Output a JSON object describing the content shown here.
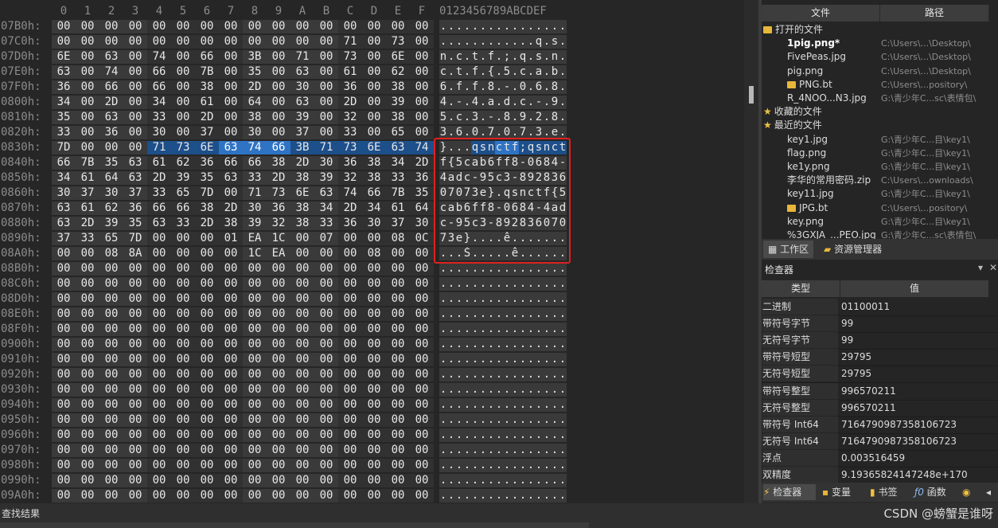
{
  "hex": {
    "col_headers": [
      "0",
      "1",
      "2",
      "3",
      "4",
      "5",
      "6",
      "7",
      "8",
      "9",
      "A",
      "B",
      "C",
      "D",
      "E",
      "F"
    ],
    "ascii_header": "0123456789ABCDEF",
    "rows": [
      {
        "addr": "07B0h:",
        "bytes": [
          "00",
          "00",
          "00",
          "00",
          "00",
          "00",
          "00",
          "00",
          "00",
          "00",
          "00",
          "00",
          "00",
          "00",
          "00",
          "00"
        ],
        "ascii": "................"
      },
      {
        "addr": "07C0h:",
        "bytes": [
          "00",
          "00",
          "00",
          "00",
          "00",
          "00",
          "00",
          "00",
          "00",
          "00",
          "00",
          "00",
          "71",
          "00",
          "73",
          "00"
        ],
        "ascii": "............q.s."
      },
      {
        "addr": "07D0h:",
        "bytes": [
          "6E",
          "00",
          "63",
          "00",
          "74",
          "00",
          "66",
          "00",
          "3B",
          "00",
          "71",
          "00",
          "73",
          "00",
          "6E",
          "00"
        ],
        "ascii": "n.c.t.f.;.q.s.n."
      },
      {
        "addr": "07E0h:",
        "bytes": [
          "63",
          "00",
          "74",
          "00",
          "66",
          "00",
          "7B",
          "00",
          "35",
          "00",
          "63",
          "00",
          "61",
          "00",
          "62",
          "00"
        ],
        "ascii": "c.t.f.{.5.c.a.b."
      },
      {
        "addr": "07F0h:",
        "bytes": [
          "36",
          "00",
          "66",
          "00",
          "66",
          "00",
          "38",
          "00",
          "2D",
          "00",
          "30",
          "00",
          "36",
          "00",
          "38",
          "00"
        ],
        "ascii": "6.f.f.8.-.0.6.8."
      },
      {
        "addr": "0800h:",
        "bytes": [
          "34",
          "00",
          "2D",
          "00",
          "34",
          "00",
          "61",
          "00",
          "64",
          "00",
          "63",
          "00",
          "2D",
          "00",
          "39",
          "00"
        ],
        "ascii": "4.-.4.a.d.c.-.9."
      },
      {
        "addr": "0810h:",
        "bytes": [
          "35",
          "00",
          "63",
          "00",
          "33",
          "00",
          "2D",
          "00",
          "38",
          "00",
          "39",
          "00",
          "32",
          "00",
          "38",
          "00"
        ],
        "ascii": "5.c.3.-.8.9.2.8."
      },
      {
        "addr": "0820h:",
        "bytes": [
          "33",
          "00",
          "36",
          "00",
          "30",
          "00",
          "37",
          "00",
          "30",
          "00",
          "37",
          "00",
          "33",
          "00",
          "65",
          "00"
        ],
        "ascii": "3.6.0.7.0.7.3.e."
      },
      {
        "addr": "0830h:",
        "bytes": [
          "7D",
          "00",
          "00",
          "00",
          "71",
          "73",
          "6E",
          "63",
          "74",
          "66",
          "3B",
          "71",
          "73",
          "6E",
          "63",
          "74"
        ],
        "ascii": "}...qsnctf;qsnct"
      },
      {
        "addr": "0840h:",
        "bytes": [
          "66",
          "7B",
          "35",
          "63",
          "61",
          "62",
          "36",
          "66",
          "66",
          "38",
          "2D",
          "30",
          "36",
          "38",
          "34",
          "2D"
        ],
        "ascii": "f{5cab6ff8-0684-"
      },
      {
        "addr": "0850h:",
        "bytes": [
          "34",
          "61",
          "64",
          "63",
          "2D",
          "39",
          "35",
          "63",
          "33",
          "2D",
          "38",
          "39",
          "32",
          "38",
          "33",
          "36"
        ],
        "ascii": "4adc-95c3-892836"
      },
      {
        "addr": "0860h:",
        "bytes": [
          "30",
          "37",
          "30",
          "37",
          "33",
          "65",
          "7D",
          "00",
          "71",
          "73",
          "6E",
          "63",
          "74",
          "66",
          "7B",
          "35"
        ],
        "ascii": "07073e}.qsnctf{5"
      },
      {
        "addr": "0870h:",
        "bytes": [
          "63",
          "61",
          "62",
          "36",
          "66",
          "66",
          "38",
          "2D",
          "30",
          "36",
          "38",
          "34",
          "2D",
          "34",
          "61",
          "64"
        ],
        "ascii": "cab6ff8-0684-4ad"
      },
      {
        "addr": "0880h:",
        "bytes": [
          "63",
          "2D",
          "39",
          "35",
          "63",
          "33",
          "2D",
          "38",
          "39",
          "32",
          "38",
          "33",
          "36",
          "30",
          "37",
          "30"
        ],
        "ascii": "c-95c3-892836070"
      },
      {
        "addr": "0890h:",
        "bytes": [
          "37",
          "33",
          "65",
          "7D",
          "00",
          "00",
          "00",
          "01",
          "EA",
          "1C",
          "00",
          "07",
          "00",
          "00",
          "08",
          "0C"
        ],
        "ascii": "73e}....ê......."
      },
      {
        "addr": "08A0h:",
        "bytes": [
          "00",
          "00",
          "08",
          "8A",
          "00",
          "00",
          "00",
          "00",
          "1C",
          "EA",
          "00",
          "00",
          "00",
          "08",
          "00",
          "00"
        ],
        "ascii": "...Š.....ê......"
      },
      {
        "addr": "08B0h:",
        "bytes": [
          "00",
          "00",
          "00",
          "00",
          "00",
          "00",
          "00",
          "00",
          "00",
          "00",
          "00",
          "00",
          "00",
          "00",
          "00",
          "00"
        ],
        "ascii": "................"
      },
      {
        "addr": "08C0h:",
        "bytes": [
          "00",
          "00",
          "00",
          "00",
          "00",
          "00",
          "00",
          "00",
          "00",
          "00",
          "00",
          "00",
          "00",
          "00",
          "00",
          "00"
        ],
        "ascii": "................"
      },
      {
        "addr": "08D0h:",
        "bytes": [
          "00",
          "00",
          "00",
          "00",
          "00",
          "00",
          "00",
          "00",
          "00",
          "00",
          "00",
          "00",
          "00",
          "00",
          "00",
          "00"
        ],
        "ascii": "................"
      },
      {
        "addr": "08E0h:",
        "bytes": [
          "00",
          "00",
          "00",
          "00",
          "00",
          "00",
          "00",
          "00",
          "00",
          "00",
          "00",
          "00",
          "00",
          "00",
          "00",
          "00"
        ],
        "ascii": "................"
      },
      {
        "addr": "08F0h:",
        "bytes": [
          "00",
          "00",
          "00",
          "00",
          "00",
          "00",
          "00",
          "00",
          "00",
          "00",
          "00",
          "00",
          "00",
          "00",
          "00",
          "00"
        ],
        "ascii": "................"
      },
      {
        "addr": "0900h:",
        "bytes": [
          "00",
          "00",
          "00",
          "00",
          "00",
          "00",
          "00",
          "00",
          "00",
          "00",
          "00",
          "00",
          "00",
          "00",
          "00",
          "00"
        ],
        "ascii": "................"
      },
      {
        "addr": "0910h:",
        "bytes": [
          "00",
          "00",
          "00",
          "00",
          "00",
          "00",
          "00",
          "00",
          "00",
          "00",
          "00",
          "00",
          "00",
          "00",
          "00",
          "00"
        ],
        "ascii": "................"
      },
      {
        "addr": "0920h:",
        "bytes": [
          "00",
          "00",
          "00",
          "00",
          "00",
          "00",
          "00",
          "00",
          "00",
          "00",
          "00",
          "00",
          "00",
          "00",
          "00",
          "00"
        ],
        "ascii": "................"
      },
      {
        "addr": "0930h:",
        "bytes": [
          "00",
          "00",
          "00",
          "00",
          "00",
          "00",
          "00",
          "00",
          "00",
          "00",
          "00",
          "00",
          "00",
          "00",
          "00",
          "00"
        ],
        "ascii": "................"
      },
      {
        "addr": "0940h:",
        "bytes": [
          "00",
          "00",
          "00",
          "00",
          "00",
          "00",
          "00",
          "00",
          "00",
          "00",
          "00",
          "00",
          "00",
          "00",
          "00",
          "00"
        ],
        "ascii": "................"
      },
      {
        "addr": "0950h:",
        "bytes": [
          "00",
          "00",
          "00",
          "00",
          "00",
          "00",
          "00",
          "00",
          "00",
          "00",
          "00",
          "00",
          "00",
          "00",
          "00",
          "00"
        ],
        "ascii": "................"
      },
      {
        "addr": "0960h:",
        "bytes": [
          "00",
          "00",
          "00",
          "00",
          "00",
          "00",
          "00",
          "00",
          "00",
          "00",
          "00",
          "00",
          "00",
          "00",
          "00",
          "00"
        ],
        "ascii": "................"
      },
      {
        "addr": "0970h:",
        "bytes": [
          "00",
          "00",
          "00",
          "00",
          "00",
          "00",
          "00",
          "00",
          "00",
          "00",
          "00",
          "00",
          "00",
          "00",
          "00",
          "00"
        ],
        "ascii": "................"
      },
      {
        "addr": "0980h:",
        "bytes": [
          "00",
          "00",
          "00",
          "00",
          "00",
          "00",
          "00",
          "00",
          "00",
          "00",
          "00",
          "00",
          "00",
          "00",
          "00",
          "00"
        ],
        "ascii": "................"
      },
      {
        "addr": "0990h:",
        "bytes": [
          "00",
          "00",
          "00",
          "00",
          "00",
          "00",
          "00",
          "00",
          "00",
          "00",
          "00",
          "00",
          "00",
          "00",
          "00",
          "00"
        ],
        "ascii": "................"
      },
      {
        "addr": "09A0h:",
        "bytes": [
          "00",
          "00",
          "00",
          "00",
          "00",
          "00",
          "00",
          "00",
          "00",
          "00",
          "00",
          "00",
          "00",
          "00",
          "00",
          "00"
        ],
        "ascii": "................"
      }
    ],
    "selection": {
      "row": 8,
      "from": 4,
      "cursor_from": 7,
      "cursor_to": 9,
      "to": 15
    }
  },
  "file_panel": {
    "col_file": "文件",
    "col_path": "路径",
    "items": [
      {
        "type": "folder",
        "indent": 0,
        "name": "打开的文件",
        "path": ""
      },
      {
        "type": "file",
        "indent": 1,
        "name": "1pig.png*",
        "path": "C:\\Users\\...\\Desktop\\",
        "bold": true
      },
      {
        "type": "file",
        "indent": 1,
        "name": "FivePeas.jpg",
        "path": "C:\\Users\\...\\Desktop\\"
      },
      {
        "type": "file",
        "indent": 1,
        "name": "pig.png",
        "path": "C:\\Users\\...\\Desktop\\"
      },
      {
        "type": "folder",
        "indent": 1,
        "name": "PNG.bt",
        "path": "C:\\Users\\...pository\\"
      },
      {
        "type": "file",
        "indent": 1,
        "name": "R_4NOO...N3.jpg",
        "path": "G:\\青少年C...sc\\表情包\\"
      },
      {
        "type": "star",
        "indent": 0,
        "name": "收藏的文件",
        "path": ""
      },
      {
        "type": "star",
        "indent": 0,
        "name": "最近的文件",
        "path": ""
      },
      {
        "type": "file",
        "indent": 1,
        "name": "key1.jpg",
        "path": "G:\\青少年C...目\\key1\\"
      },
      {
        "type": "file",
        "indent": 1,
        "name": "flag.png",
        "path": "G:\\青少年C...目\\key1\\"
      },
      {
        "type": "file",
        "indent": 1,
        "name": "ke1y.png",
        "path": "G:\\青少年C...目\\key1\\"
      },
      {
        "type": "file",
        "indent": 1,
        "name": "李华的常用密码.zip",
        "path": "C:\\Users\\...ownloads\\"
      },
      {
        "type": "file",
        "indent": 1,
        "name": "key11.jpg",
        "path": "G:\\青少年C...目\\key1\\"
      },
      {
        "type": "folder",
        "indent": 1,
        "name": "JPG.bt",
        "path": "C:\\Users\\...pository\\"
      },
      {
        "type": "file",
        "indent": 1,
        "name": "key.png",
        "path": "G:\\青少年C...目\\key1\\"
      },
      {
        "type": "file",
        "indent": 1,
        "name": "%3GXJA_...PEO.jpg",
        "path": "G:\\青少年C...sc\\表情包\\"
      }
    ]
  },
  "mid_tabs": {
    "workspace": "工作区",
    "explorer": "资源管理器"
  },
  "inspector": {
    "title": "检查器",
    "col_type": "类型",
    "col_value": "值",
    "rows": [
      {
        "k": "二进制",
        "v": "01100011"
      },
      {
        "k": "带符号字节",
        "v": "99"
      },
      {
        "k": "无符号字节",
        "v": "99"
      },
      {
        "k": "带符号短型",
        "v": "29795"
      },
      {
        "k": "无符号短型",
        "v": "29795"
      },
      {
        "k": "带符号整型",
        "v": "996570211"
      },
      {
        "k": "无符号整型",
        "v": "996570211"
      },
      {
        "k": "带符号 Int64",
        "v": "7164790987358106723"
      },
      {
        "k": "无符号 Int64",
        "v": "7164790987358106723"
      },
      {
        "k": "浮点",
        "v": "0.003516459"
      },
      {
        "k": "双精度",
        "v": "9.19365824147248e+170"
      }
    ]
  },
  "bottom_tabs": {
    "inspector": "检查器",
    "vars": "变量",
    "bookmarks": "书签",
    "funcs": "函数"
  },
  "find": {
    "title": "查找结果"
  },
  "watermark": "CSDN @螃蟹是谁呀"
}
